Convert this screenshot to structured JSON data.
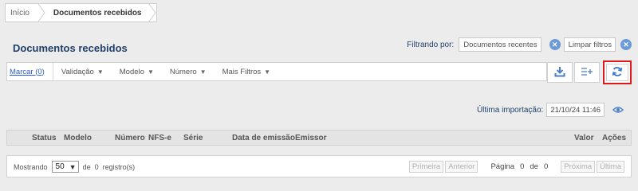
{
  "breadcrumb": {
    "home": "Início",
    "current": "Documentos recebidos"
  },
  "page": {
    "title": "Documentos recebidos"
  },
  "filters": {
    "label": "Filtrando por:",
    "active_chip": "Documentos recentes",
    "clear_label": "Limpar filtros"
  },
  "toolbar": {
    "mark": "Marcar (0)",
    "items": [
      "Validação",
      "Modelo",
      "Número",
      "Mais Filtros"
    ]
  },
  "icons": {
    "download": "download-icon",
    "columns": "columns-add-icon",
    "refresh": "refresh-icon",
    "eye": "eye-icon"
  },
  "last_import": {
    "label": "Última importação:",
    "value": "21/10/24 11:46"
  },
  "table": {
    "columns": [
      "Status",
      "Modelo",
      "Número",
      "NFS-e",
      "Série",
      "Data de emissão",
      "Emissor",
      "Valor",
      "Ações"
    ]
  },
  "footer": {
    "showing": "Mostrando",
    "page_size": "50",
    "of": "de",
    "total": "0",
    "records": "registro(s)",
    "first": "Primeira",
    "previous": "Anterior",
    "page_label": "Página",
    "page": "0",
    "page_of": "de",
    "page_total": "0",
    "next": "Próxima",
    "last": "Última"
  },
  "colors": {
    "accent": "#1f3f6a",
    "link": "#2a5bd7",
    "chip_close": "#6a9ad8",
    "highlight_border": "#e01a1a"
  }
}
